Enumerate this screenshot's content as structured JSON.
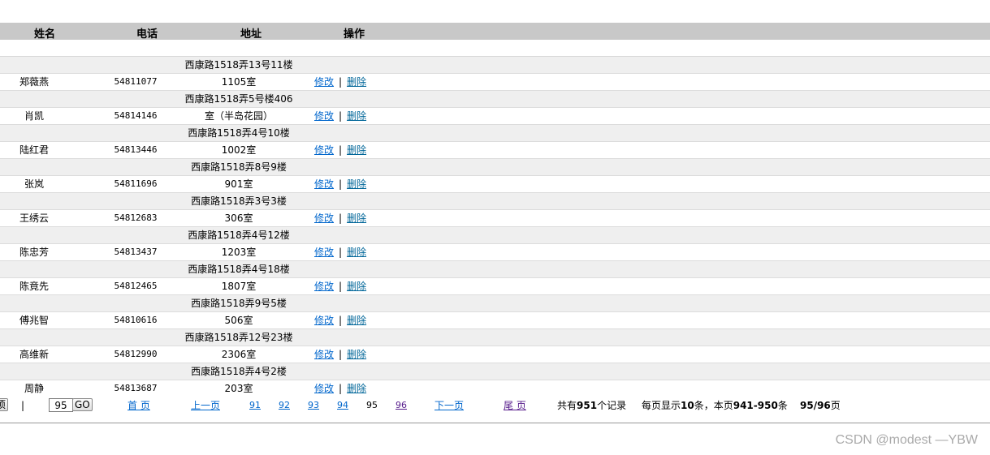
{
  "header": {
    "name": "姓名",
    "phone": "电话",
    "address": "地址",
    "operation": "操作"
  },
  "actions": {
    "edit": "修改",
    "separator": "|",
    "delete": "删除"
  },
  "records": [
    {
      "name": "郑薇燕",
      "phone": "54811077",
      "addr1": "西康路1518弄13号11楼",
      "addr2": "1105室"
    },
    {
      "name": "肖凯",
      "phone": "54814146",
      "addr1": "西康路1518弄5号楼406",
      "addr2": "室（半岛花园）"
    },
    {
      "name": "陆红君",
      "phone": "54813446",
      "addr1": "西康路1518弄4号10楼",
      "addr2": "1002室"
    },
    {
      "name": "张岚",
      "phone": "54811696",
      "addr1": "西康路1518弄8号9楼",
      "addr2": "901室"
    },
    {
      "name": "王绣云",
      "phone": "54812683",
      "addr1": "西康路1518弄3号3楼",
      "addr2": "306室"
    },
    {
      "name": "陈忠芳",
      "phone": "54813437",
      "addr1": "西康路1518弄4号12楼",
      "addr2": "1203室"
    },
    {
      "name": "陈竟先",
      "phone": "54812465",
      "addr1": "西康路1518弄4号18楼",
      "addr2": "1807室"
    },
    {
      "name": "傅兆智",
      "phone": "54810616",
      "addr1": "西康路1518弄9号5楼",
      "addr2": "506室"
    },
    {
      "name": "高维新",
      "phone": "54812990",
      "addr1": "西康路1518弄12号23楼",
      "addr2": "2306室"
    },
    {
      "name": "周静",
      "phone": "54813687",
      "addr1": "西康路1518弄4号2楼",
      "addr2": "203室"
    }
  ],
  "pager": {
    "select_label": "项",
    "bar": "|",
    "page_input": "95",
    "go_label": "GO",
    "first": "首 页",
    "prev": "上一页",
    "pages": [
      "91",
      "92",
      "93",
      "94"
    ],
    "current": "95",
    "after": "96",
    "next": "下一页",
    "last": "尾 页",
    "total_prefix": "共有",
    "total_count": "951",
    "total_suffix": "个记录",
    "per_page_prefix": "每页显示",
    "per_page": "10",
    "per_page_mid": "条，本页",
    "range": "941-950",
    "per_page_suffix": "条",
    "page_of": "95/96",
    "page_suffix": "页"
  },
  "watermark": "CSDN @modest —YBW"
}
